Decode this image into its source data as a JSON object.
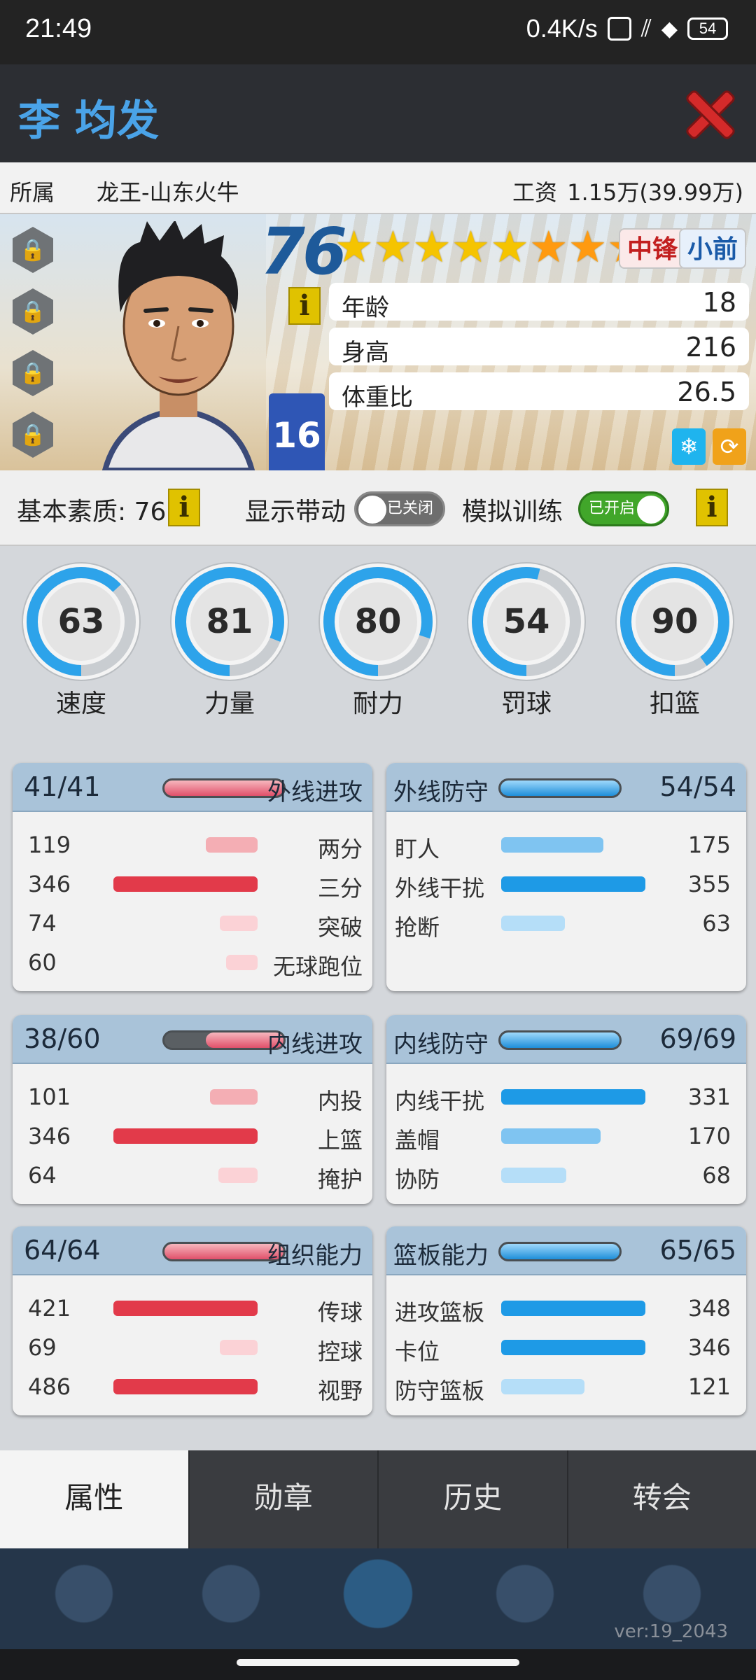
{
  "status": {
    "time": "21:49",
    "speed": "0.4K/s",
    "battery": "54"
  },
  "player": {
    "name": "李 均发",
    "team_label": "所属",
    "team": "龙王-山东火牛",
    "salary_label": "工资",
    "salary": "1.15万(39.99万)"
  },
  "hero": {
    "overall": "76",
    "stars_gold": 5,
    "stars_orange": 3,
    "positions": [
      "中锋",
      "小前"
    ],
    "jersey_number": "16",
    "bio": [
      {
        "label": "年龄",
        "value": "18"
      },
      {
        "label": "身高",
        "value": "216"
      },
      {
        "label": "体重比",
        "value": "26.5"
      }
    ]
  },
  "settings": {
    "base_label": "基本素质: 76",
    "show_label": "显示带动",
    "show_state": "已关闭",
    "sim_label": "模拟训练",
    "sim_state": "已开启"
  },
  "gauges": [
    {
      "value": "63",
      "label": "速度",
      "fraction": 0.63
    },
    {
      "value": "81",
      "label": "力量",
      "fraction": 0.81
    },
    {
      "value": "80",
      "label": "耐力",
      "fraction": 0.8
    },
    {
      "value": "54",
      "label": "罚球",
      "fraction": 0.54
    },
    {
      "value": "90",
      "label": "扣篮",
      "fraction": 0.9
    }
  ],
  "cards": {
    "outside_offense": {
      "title": "外线进攻",
      "score": "41/41",
      "fill": 1.0,
      "rows": [
        {
          "num": "119",
          "label": "两分",
          "level": 0.36
        },
        {
          "num": "346",
          "label": "三分",
          "level": 1.0
        },
        {
          "num": "74",
          "label": "突破",
          "level": 0.26
        },
        {
          "num": "60",
          "label": "无球跑位",
          "level": 0.22
        }
      ]
    },
    "outside_defense": {
      "title": "外线防守",
      "score": "54/54",
      "fill": 1.0,
      "rows": [
        {
          "num": "175",
          "label": "盯人",
          "level": 0.71
        },
        {
          "num": "355",
          "label": "外线干扰",
          "level": 1.0
        },
        {
          "num": "63",
          "label": "抢断",
          "level": 0.44
        }
      ]
    },
    "inside_offense": {
      "title": "内线进攻",
      "score": "38/60",
      "fill": 0.63,
      "rows": [
        {
          "num": "101",
          "label": "内投",
          "level": 0.33
        },
        {
          "num": "346",
          "label": "上篮",
          "level": 1.0
        },
        {
          "num": "64",
          "label": "掩护",
          "level": 0.27
        }
      ]
    },
    "inside_defense": {
      "title": "内线防守",
      "score": "69/69",
      "fill": 1.0,
      "rows": [
        {
          "num": "331",
          "label": "内线干扰",
          "level": 1.0
        },
        {
          "num": "170",
          "label": "盖帽",
          "level": 0.69
        },
        {
          "num": "68",
          "label": "协防",
          "level": 0.45
        }
      ]
    },
    "playmaking": {
      "title": "组织能力",
      "score": "64/64",
      "fill": 1.0,
      "rows": [
        {
          "num": "421",
          "label": "传球",
          "level": 1.0
        },
        {
          "num": "69",
          "label": "控球",
          "level": 0.26
        },
        {
          "num": "486",
          "label": "视野",
          "level": 1.0
        }
      ]
    },
    "rebounding": {
      "title": "篮板能力",
      "score": "65/65",
      "fill": 1.0,
      "rows": [
        {
          "num": "348",
          "label": "进攻篮板",
          "level": 1.0
        },
        {
          "num": "346",
          "label": "卡位",
          "level": 1.0
        },
        {
          "num": "121",
          "label": "防守篮板",
          "level": 0.58
        }
      ]
    }
  },
  "tabs": [
    "属性",
    "勋章",
    "历史",
    "转会"
  ],
  "version": "ver:19_2043",
  "colors": {
    "accent_blue": "#4aa3e8",
    "close_red": "#d42a2a",
    "offense_red": "#e23a4a",
    "defense_blue": "#1e9ae6"
  }
}
